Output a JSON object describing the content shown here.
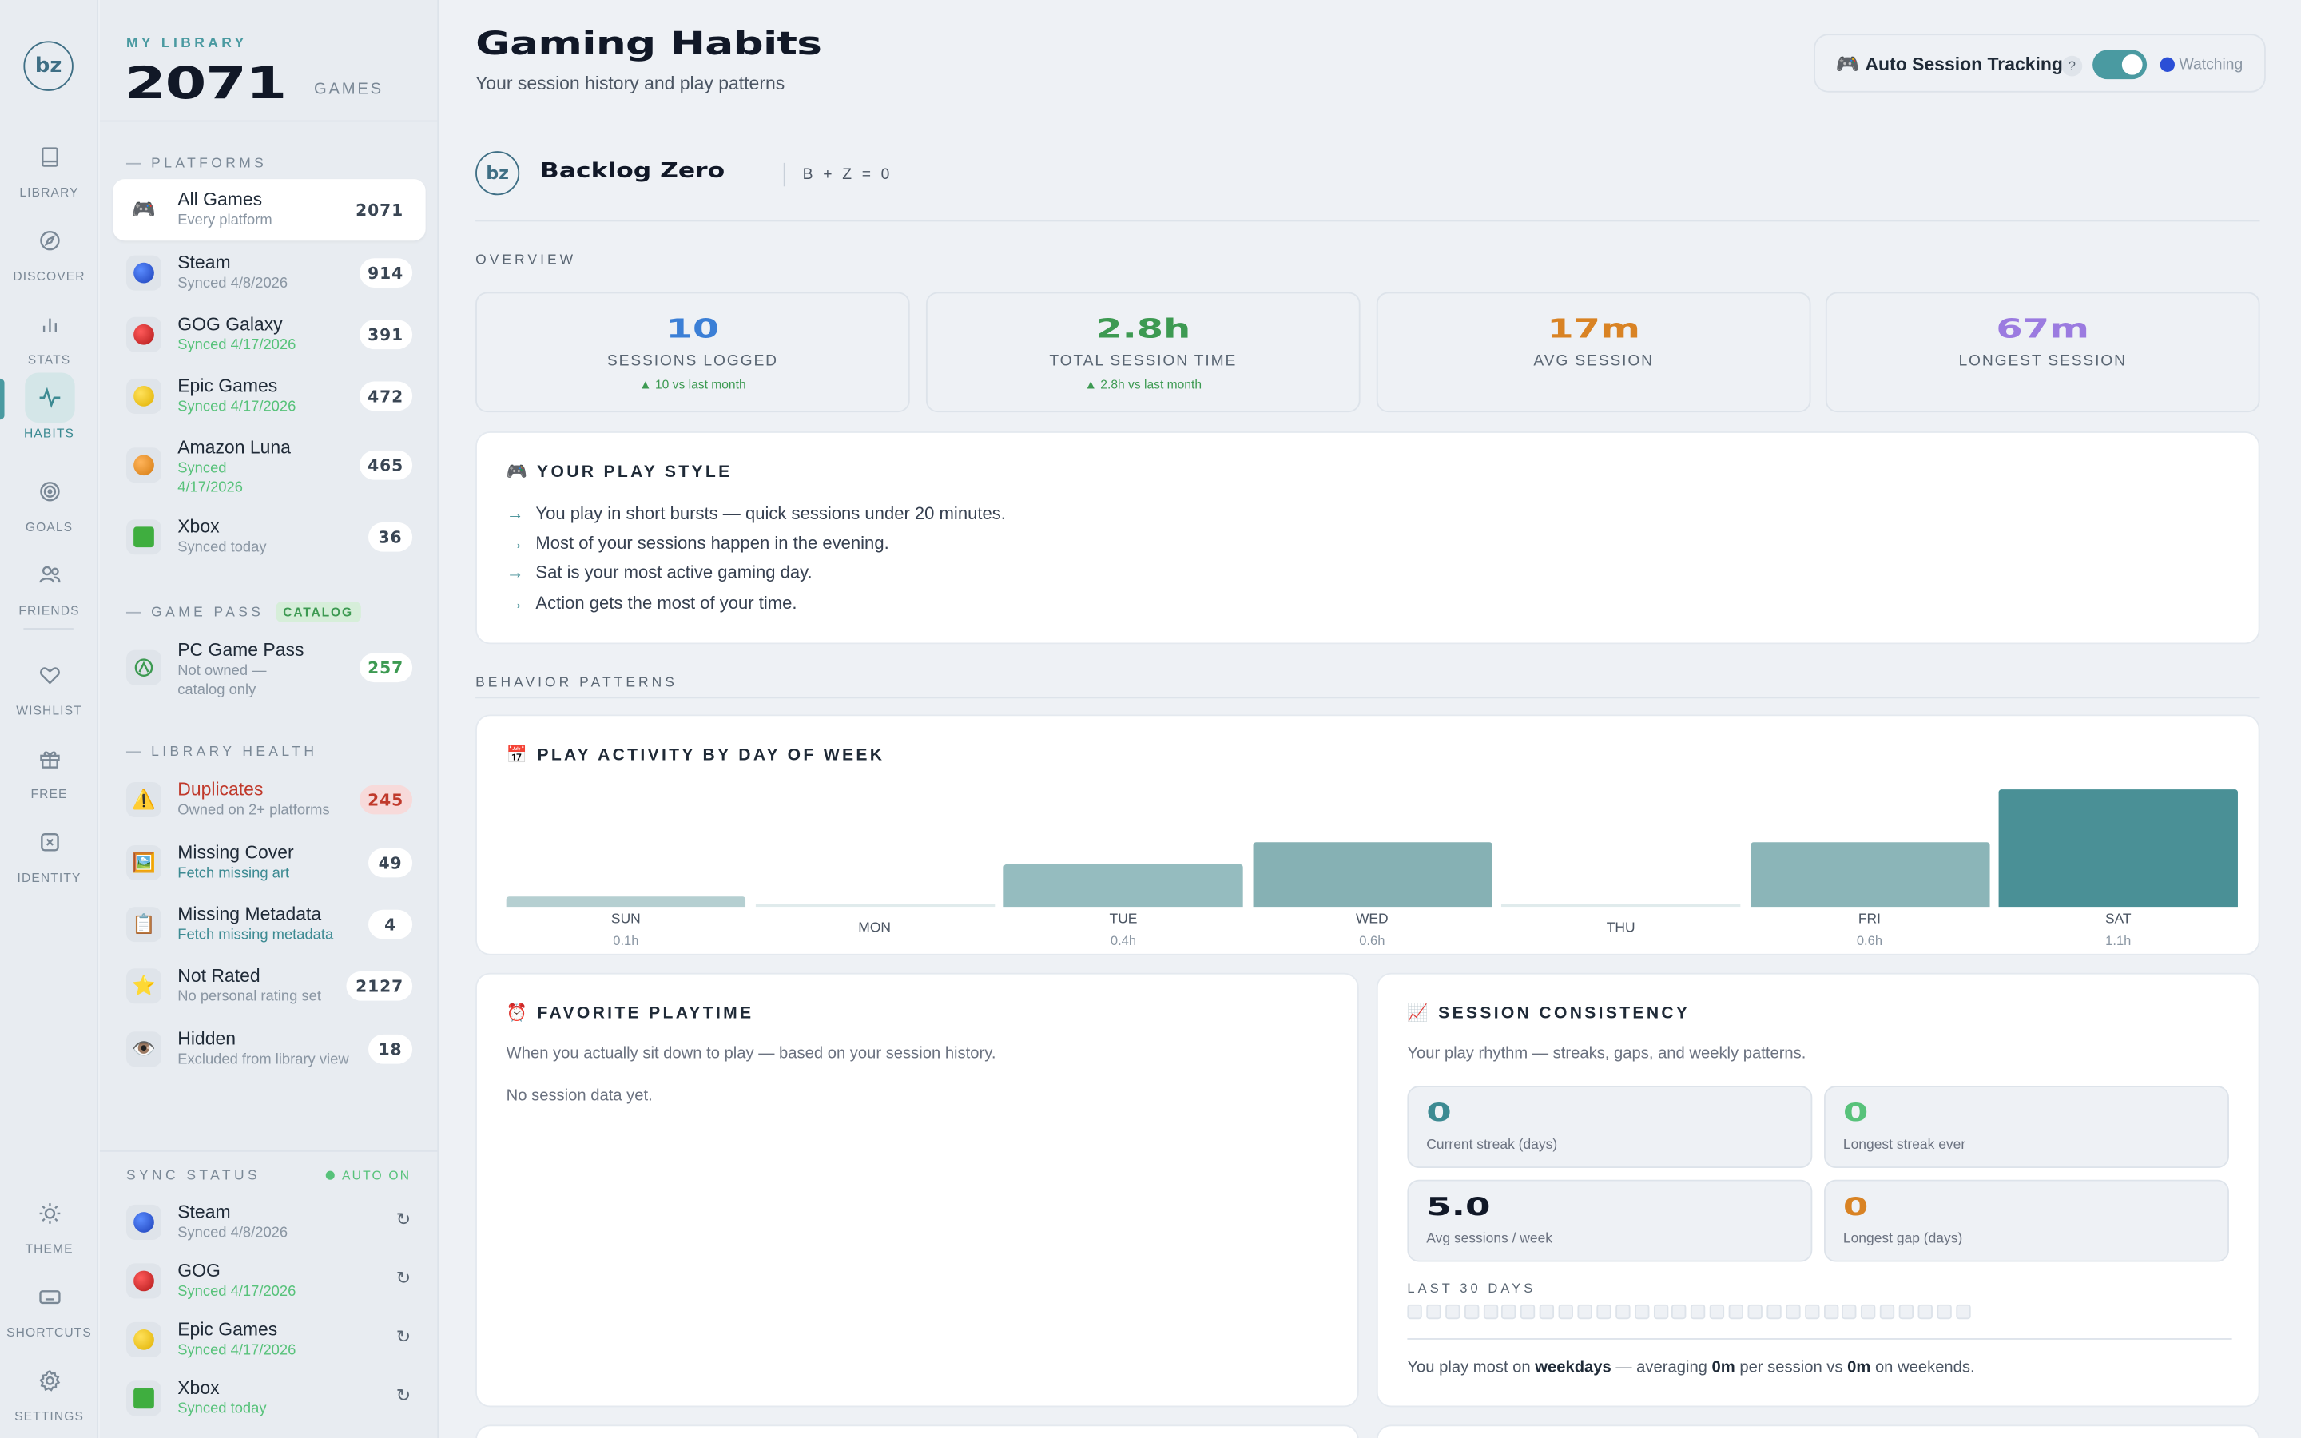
{
  "rail": {
    "logo": "bz",
    "items": [
      {
        "label": "LIBRARY",
        "icon": "book-icon"
      },
      {
        "label": "DISCOVER",
        "icon": "compass-icon"
      },
      {
        "label": "STATS",
        "icon": "bar-chart-icon"
      },
      {
        "label": "HABITS",
        "icon": "pulse-icon"
      },
      {
        "label": "GOALS",
        "icon": "target-icon"
      },
      {
        "label": "FRIENDS",
        "icon": "users-icon"
      },
      {
        "label": "WISHLIST",
        "icon": "heart-icon"
      },
      {
        "label": "FREE",
        "icon": "gift-icon"
      },
      {
        "label": "IDENTITY",
        "icon": "id-icon"
      },
      {
        "label": "THEME",
        "icon": "sun-icon"
      },
      {
        "label": "SHORTCUTS",
        "icon": "keyboard-icon"
      },
      {
        "label": "SETTINGS",
        "icon": "gear-icon"
      }
    ]
  },
  "sidebar": {
    "kicker": "MY LIBRARY",
    "count": "2071",
    "unit": "GAMES",
    "platforms_head": "PLATFORMS",
    "platforms": [
      {
        "name": "All Games",
        "sub": "Every platform",
        "count": "2071"
      },
      {
        "name": "Steam",
        "sub": "Synced 4/8/2026",
        "count": "914"
      },
      {
        "name": "GOG Galaxy",
        "sub": "Synced 4/17/2026",
        "count": "391"
      },
      {
        "name": "Epic Games",
        "sub": "Synced 4/17/2026",
        "count": "472"
      },
      {
        "name": "Amazon Luna",
        "sub": "Synced 4/17/2026",
        "count": "465"
      },
      {
        "name": "Xbox",
        "sub": "Synced today",
        "count": "36"
      }
    ],
    "gamepass_head": "GAME PASS",
    "gamepass_tag": "CATALOG",
    "gamepass": {
      "name": "PC Game Pass",
      "sub": "Not owned — catalog only",
      "count": "257"
    },
    "health_head": "LIBRARY HEALTH",
    "health": [
      {
        "name": "Duplicates",
        "sub": "Owned on 2+ platforms",
        "count": "245"
      },
      {
        "name": "Missing Cover",
        "sub": "Fetch missing art",
        "count": "49"
      },
      {
        "name": "Missing Metadata",
        "sub": "Fetch missing metadata",
        "count": "4"
      },
      {
        "name": "Not Rated",
        "sub": "No personal rating set",
        "count": "2127"
      },
      {
        "name": "Hidden",
        "sub": "Excluded from library view",
        "count": "18"
      }
    ],
    "sync_head": "SYNC STATUS",
    "sync_auto": "AUTO ON",
    "sync": [
      {
        "name": "Steam",
        "sub": "Synced 4/8/2026"
      },
      {
        "name": "GOG",
        "sub": "Synced 4/17/2026"
      },
      {
        "name": "Epic Games",
        "sub": "Synced 4/17/2026"
      },
      {
        "name": "Xbox",
        "sub": "Synced today"
      }
    ]
  },
  "header": {
    "title": "Gaming Habits",
    "subtitle": "Your session history and play patterns",
    "tracking_label": "Auto Session Tracking",
    "help": "?",
    "watch_label": "Watching"
  },
  "brand": {
    "name": "Backlog Zero",
    "formula": "B + Z = 0",
    "logo": "bz"
  },
  "overview": {
    "kicker": "OVERVIEW",
    "cards": [
      {
        "value": "10",
        "label": "SESSIONS LOGGED",
        "delta": "▲ 10 vs last month",
        "color": "#3b7fd6"
      },
      {
        "value": "2.8h",
        "label": "TOTAL SESSION TIME",
        "delta": "▲ 2.8h vs last month",
        "color": "#3d9a52"
      },
      {
        "value": "17m",
        "label": "AVG SESSION",
        "delta": "",
        "color": "#d98324"
      },
      {
        "value": "67m",
        "label": "LONGEST SESSION",
        "delta": "",
        "color": "#9b7be0"
      }
    ]
  },
  "play_style": {
    "title": "🎮 YOUR PLAY STYLE",
    "items": [
      "You play in short bursts — quick sessions under 20 minutes.",
      "Most of your sessions happen in the evening.",
      "Sat is your most active gaming day.",
      "Action gets the most of your time."
    ]
  },
  "behavior_kicker": "BEHAVIOR PATTERNS",
  "activity": {
    "title": "📅 PLAY ACTIVITY BY DAY OF WEEK",
    "days": [
      {
        "day": "SUN",
        "hours": "0.1h",
        "value": 0.1
      },
      {
        "day": "MON",
        "hours": "",
        "value": 0
      },
      {
        "day": "TUE",
        "hours": "0.4h",
        "value": 0.4
      },
      {
        "day": "WED",
        "hours": "0.6h",
        "value": 0.6
      },
      {
        "day": "THU",
        "hours": "",
        "value": 0
      },
      {
        "day": "FRI",
        "hours": "0.6h",
        "value": 0.6
      },
      {
        "day": "SAT",
        "hours": "1.1h",
        "value": 1.1
      }
    ]
  },
  "playtime": {
    "title": "⏰ FAVORITE PLAYTIME",
    "desc": "When you actually sit down to play — based on your session history.",
    "empty": "No session data yet."
  },
  "consistency": {
    "title": "📈 SESSION CONSISTENCY",
    "desc": "Your play rhythm — streaks, gaps, and weekly patterns.",
    "cards": [
      {
        "value": "0",
        "label": "Current streak (days)",
        "color": "#3c8a92"
      },
      {
        "value": "0",
        "label": "Longest streak ever",
        "color": "#57c27a"
      },
      {
        "value": "5.0",
        "label": "Avg sessions / week",
        "color": "#111827"
      },
      {
        "value": "0",
        "label": "Longest gap (days)",
        "color": "#d98324"
      }
    ],
    "heat_label": "LAST 30 DAYS",
    "summary_pre": "You play most on ",
    "summary_days": "weekdays",
    "summary_mid": " — averaging ",
    "summary_wd": "0m",
    "summary_mid2": " per session vs ",
    "summary_we": "0m",
    "summary_post": " on weekends."
  }
}
